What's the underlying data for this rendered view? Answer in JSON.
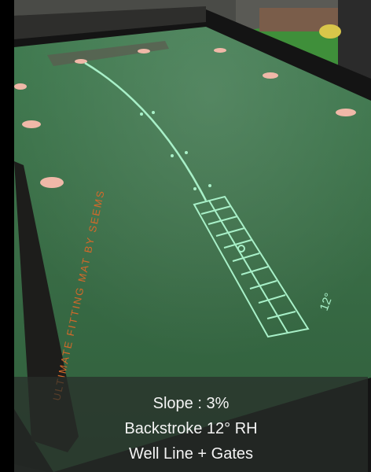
{
  "photo": {
    "mat_brand_text": "ULTIMATE FITTING MAT BY SEEMS",
    "angle_label": "12°",
    "colors": {
      "mat_green": "#3a6e47",
      "projection_line": "#a8f0c8",
      "target_discs": "#f0b8a8",
      "frame_black": "#141414",
      "brand_orange": "#d4692a"
    }
  },
  "caption": {
    "line1": "Slope : 3%",
    "line2": "Backstroke 12° RH",
    "line3": "Well Line + Gates"
  }
}
